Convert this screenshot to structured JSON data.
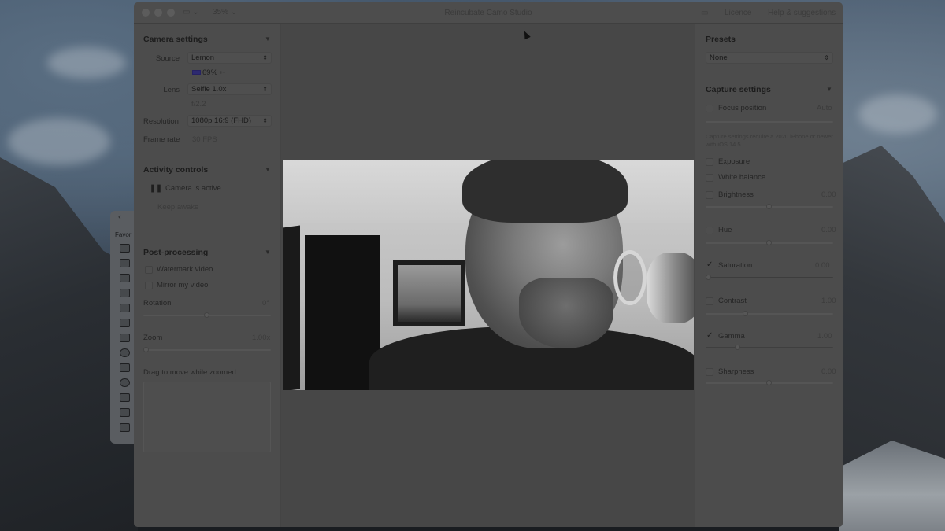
{
  "window": {
    "title": "Reincubate Camo Studio",
    "zoom": "35%",
    "links": [
      "Licence",
      "Help & suggestions"
    ]
  },
  "left": {
    "camera": {
      "heading": "Camera settings",
      "source_label": "Source",
      "source_value": "Lemon",
      "battery": "69%",
      "lens_label": "Lens",
      "lens_value": "Selfie 1.0x",
      "aperture": "f/2.2",
      "resolution_label": "Resolution",
      "resolution_value": "1080p 16:9 (FHD)",
      "framerate_label": "Frame rate",
      "framerate_value": "30 FPS"
    },
    "activity": {
      "heading": "Activity controls",
      "status": "Camera is active",
      "secondary": "Keep awake"
    },
    "post": {
      "heading": "Post-processing",
      "watermark": "Watermark video",
      "mirror": "Mirror my video",
      "rotation_label": "Rotation",
      "rotation_value": "0°",
      "rotation_level": 0.5,
      "zoom_label": "Zoom",
      "zoom_value": "1.00x",
      "zoom_level": 0.0,
      "drag_hint": "Drag to move while zoomed"
    }
  },
  "right": {
    "presets": {
      "heading": "Presets",
      "value": "None"
    },
    "capture": {
      "heading": "Capture settings",
      "focus_label": "Focus position",
      "focus_value": "Auto",
      "note": "Capture settings require a 2020 iPhone or newer with iOS 14.5",
      "exposure": "Exposure",
      "white_balance": "White balance",
      "brightness_label": "Brightness",
      "brightness_value": "0.00",
      "hue_label": "Hue",
      "hue_value": "0.00",
      "saturation_label": "Saturation",
      "saturation_value": "0.00",
      "contrast_label": "Contrast",
      "contrast_value": "1.00",
      "gamma_label": "Gamma",
      "gamma_value": "1.00",
      "sharpness_label": "Sharpness",
      "sharpness_value": "0.00"
    }
  },
  "finder": {
    "favorites_label": "Favori"
  }
}
